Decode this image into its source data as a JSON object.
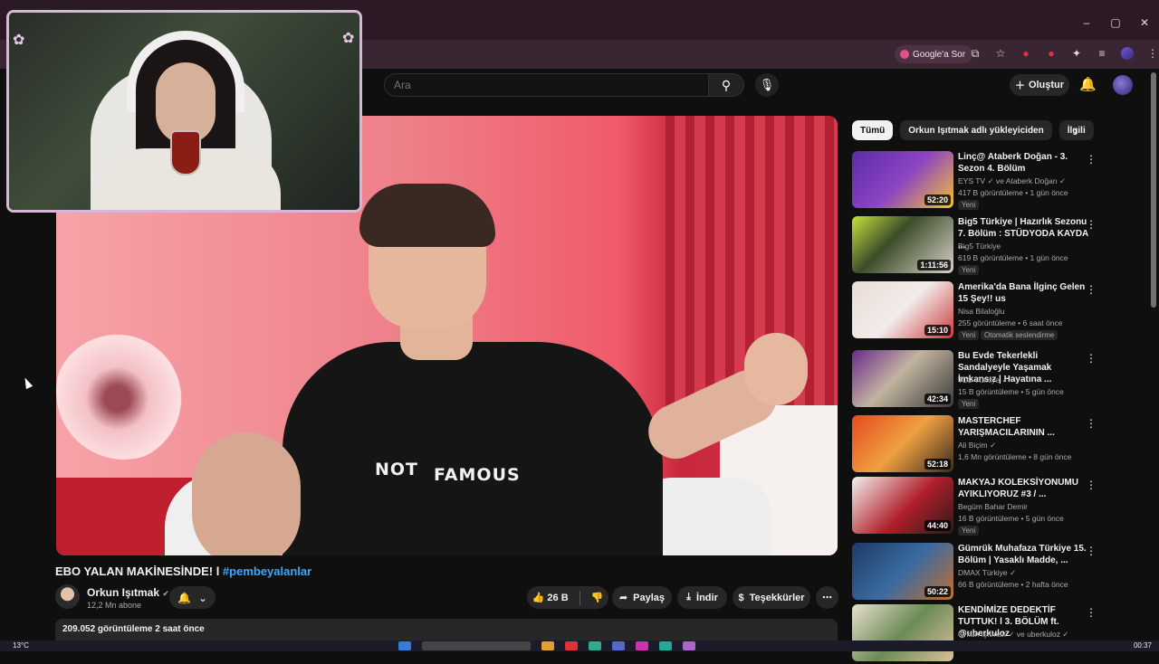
{
  "window": {
    "minimize": "–",
    "maximize": "▢",
    "close": "✕"
  },
  "toolbar": {
    "google_ask": "Google'a Sor"
  },
  "header": {
    "search_placeholder": "Ara",
    "create_label": "Oluştur"
  },
  "video": {
    "shirt_word1": "NOT",
    "shirt_word2": "FAMOUS",
    "title_main": "EBO YALAN MAKİNESİNDE! l ",
    "title_hashtag": "#pembeyalanlar",
    "channel_name": "Orkun Işıtmak",
    "subscribers": "12,2 Mn abone",
    "likes": "26 B",
    "share_label": "Paylaş",
    "download_label": "İndir",
    "thanks_label": "Teşekkürler",
    "views_line": "209.052 görüntüleme  2 saat önce"
  },
  "chips": [
    "Tümü",
    "Orkun Işıtmak adlı yükleyiciden",
    "İlgili"
  ],
  "recommendations": [
    {
      "title": "Linç@ Ataberk Doğan - 3. Sezon 4. Bölüm",
      "channel": "EYS TV ✓ ve Ataberk Doğan ✓",
      "meta": "417 B görüntüleme • 1 gün önce",
      "badge": "Yeni",
      "badge2": "",
      "duration": "52:20",
      "thumb": "linear-gradient(135deg,#5b2ba8,#8d44c4 50%,#f2c230)"
    },
    {
      "title": "Big5 Türkiye | Hazırlık Sezonu 7. Bölüm : STÜDYODA KAYDA ...",
      "channel": "Big5 Türkiye",
      "meta": "619 B görüntüleme • 1 gün önce",
      "badge": "Yeni",
      "badge2": "",
      "duration": "1:11:56",
      "thumb": "linear-gradient(135deg,#c7e23a,#3b4d2a 40%,#d9d1c8)"
    },
    {
      "title": "Amerika'da Bana İlginç Gelen 15 Şey!! us",
      "channel": "Nisa Bilaloğlu",
      "meta": "255 görüntüleme • 6 saat önce",
      "badge": "Yeni",
      "badge2": "Otomatik seslendirme",
      "duration": "15:10",
      "thumb": "linear-gradient(135deg,#e9dcd6,#f2ecea 50%,#c93b3b)"
    },
    {
      "title": "Bu Evde Tekerlekli Sandalyeyle Yaşamak İmkansız | Hayatına ...",
      "channel": "TLC Türkiye ✓",
      "meta": "15 B görüntüleme • 5 gün önce",
      "badge": "Yeni",
      "badge2": "",
      "duration": "42:34",
      "thumb": "linear-gradient(135deg,#6a2a8a,#c2b3a0 45%,#3a3a3a)"
    },
    {
      "title": "MASTERCHEF YARIŞMACILARININ ...",
      "channel": "Ali Biçim ✓",
      "meta": "1,6 Mn görüntüleme • 8 gün önce",
      "badge": "",
      "badge2": "",
      "duration": "52:18",
      "thumb": "linear-gradient(135deg,#e34b1e,#f0a040 50%,#3a2a20)"
    },
    {
      "title": "MAKYAJ KOLEKSİYONUMU AYIKLIYORUZ #3 / ...",
      "channel": "Begüm Bahar Demir",
      "meta": "16 B görüntüleme • 5 gün önce",
      "badge": "Yeni",
      "badge2": "",
      "duration": "44:40",
      "thumb": "linear-gradient(135deg,#f3f0ee,#b01f2a 55%,#2b1b1b)"
    },
    {
      "title": "Gümrük Muhafaza Türkiye 15. Bölüm | Yasaklı Madde, ...",
      "channel": "DMAX Türkiye ✓",
      "meta": "66 B görüntüleme • 2 hafta önce",
      "badge": "",
      "badge2": "",
      "duration": "50:22",
      "thumb": "linear-gradient(135deg,#1e3a66,#3a6aa0 50%,#c07030)"
    },
    {
      "title": "KENDİMİZE DEDEKTİF TUTTUK! l 3. BÖLÜM ft. @uberkuloz",
      "channel": "Orkun Işıtmak ✓ ve uberkuloz ✓",
      "meta": "",
      "badge": "",
      "badge2": "",
      "duration": "",
      "thumb": "linear-gradient(135deg,#e8e0d0,#6b8a55 50%,#d9c09a)"
    }
  ],
  "taskbar": {
    "weather": "13°C",
    "clock": "00:37"
  }
}
